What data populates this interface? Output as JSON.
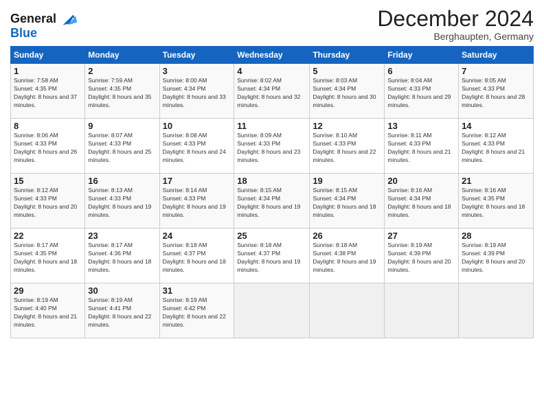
{
  "header": {
    "logo_line1": "General",
    "logo_line2": "Blue",
    "month_title": "December 2024",
    "location": "Berghaupten, Germany"
  },
  "weekdays": [
    "Sunday",
    "Monday",
    "Tuesday",
    "Wednesday",
    "Thursday",
    "Friday",
    "Saturday"
  ],
  "weeks": [
    [
      {
        "day": 1,
        "sunrise": "7:58 AM",
        "sunset": "4:35 PM",
        "daylight": "8 hours and 37 minutes."
      },
      {
        "day": 2,
        "sunrise": "7:59 AM",
        "sunset": "4:35 PM",
        "daylight": "8 hours and 35 minutes."
      },
      {
        "day": 3,
        "sunrise": "8:00 AM",
        "sunset": "4:34 PM",
        "daylight": "8 hours and 33 minutes."
      },
      {
        "day": 4,
        "sunrise": "8:02 AM",
        "sunset": "4:34 PM",
        "daylight": "8 hours and 32 minutes."
      },
      {
        "day": 5,
        "sunrise": "8:03 AM",
        "sunset": "4:34 PM",
        "daylight": "8 hours and 30 minutes."
      },
      {
        "day": 6,
        "sunrise": "8:04 AM",
        "sunset": "4:33 PM",
        "daylight": "8 hours and 29 minutes."
      },
      {
        "day": 7,
        "sunrise": "8:05 AM",
        "sunset": "4:33 PM",
        "daylight": "8 hours and 28 minutes."
      }
    ],
    [
      {
        "day": 8,
        "sunrise": "8:06 AM",
        "sunset": "4:33 PM",
        "daylight": "8 hours and 26 minutes."
      },
      {
        "day": 9,
        "sunrise": "8:07 AM",
        "sunset": "4:33 PM",
        "daylight": "8 hours and 25 minutes."
      },
      {
        "day": 10,
        "sunrise": "8:08 AM",
        "sunset": "4:33 PM",
        "daylight": "8 hours and 24 minutes."
      },
      {
        "day": 11,
        "sunrise": "8:09 AM",
        "sunset": "4:33 PM",
        "daylight": "8 hours and 23 minutes."
      },
      {
        "day": 12,
        "sunrise": "8:10 AM",
        "sunset": "4:33 PM",
        "daylight": "8 hours and 22 minutes."
      },
      {
        "day": 13,
        "sunrise": "8:11 AM",
        "sunset": "4:33 PM",
        "daylight": "8 hours and 21 minutes."
      },
      {
        "day": 14,
        "sunrise": "8:12 AM",
        "sunset": "4:33 PM",
        "daylight": "8 hours and 21 minutes."
      }
    ],
    [
      {
        "day": 15,
        "sunrise": "8:12 AM",
        "sunset": "4:33 PM",
        "daylight": "8 hours and 20 minutes."
      },
      {
        "day": 16,
        "sunrise": "8:13 AM",
        "sunset": "4:33 PM",
        "daylight": "8 hours and 19 minutes."
      },
      {
        "day": 17,
        "sunrise": "8:14 AM",
        "sunset": "4:33 PM",
        "daylight": "8 hours and 19 minutes."
      },
      {
        "day": 18,
        "sunrise": "8:15 AM",
        "sunset": "4:34 PM",
        "daylight": "8 hours and 19 minutes."
      },
      {
        "day": 19,
        "sunrise": "8:15 AM",
        "sunset": "4:34 PM",
        "daylight": "8 hours and 18 minutes."
      },
      {
        "day": 20,
        "sunrise": "8:16 AM",
        "sunset": "4:34 PM",
        "daylight": "8 hours and 18 minutes."
      },
      {
        "day": 21,
        "sunrise": "8:16 AM",
        "sunset": "4:35 PM",
        "daylight": "8 hours and 18 minutes."
      }
    ],
    [
      {
        "day": 22,
        "sunrise": "8:17 AM",
        "sunset": "4:35 PM",
        "daylight": "8 hours and 18 minutes."
      },
      {
        "day": 23,
        "sunrise": "8:17 AM",
        "sunset": "4:36 PM",
        "daylight": "8 hours and 18 minutes."
      },
      {
        "day": 24,
        "sunrise": "8:18 AM",
        "sunset": "4:37 PM",
        "daylight": "8 hours and 18 minutes."
      },
      {
        "day": 25,
        "sunrise": "8:18 AM",
        "sunset": "4:37 PM",
        "daylight": "8 hours and 19 minutes."
      },
      {
        "day": 26,
        "sunrise": "8:18 AM",
        "sunset": "4:38 PM",
        "daylight": "8 hours and 19 minutes."
      },
      {
        "day": 27,
        "sunrise": "8:19 AM",
        "sunset": "4:39 PM",
        "daylight": "8 hours and 20 minutes."
      },
      {
        "day": 28,
        "sunrise": "8:19 AM",
        "sunset": "4:39 PM",
        "daylight": "8 hours and 20 minutes."
      }
    ],
    [
      {
        "day": 29,
        "sunrise": "8:19 AM",
        "sunset": "4:40 PM",
        "daylight": "8 hours and 21 minutes."
      },
      {
        "day": 30,
        "sunrise": "8:19 AM",
        "sunset": "4:41 PM",
        "daylight": "8 hours and 22 minutes."
      },
      {
        "day": 31,
        "sunrise": "8:19 AM",
        "sunset": "4:42 PM",
        "daylight": "8 hours and 22 minutes."
      },
      null,
      null,
      null,
      null
    ]
  ]
}
